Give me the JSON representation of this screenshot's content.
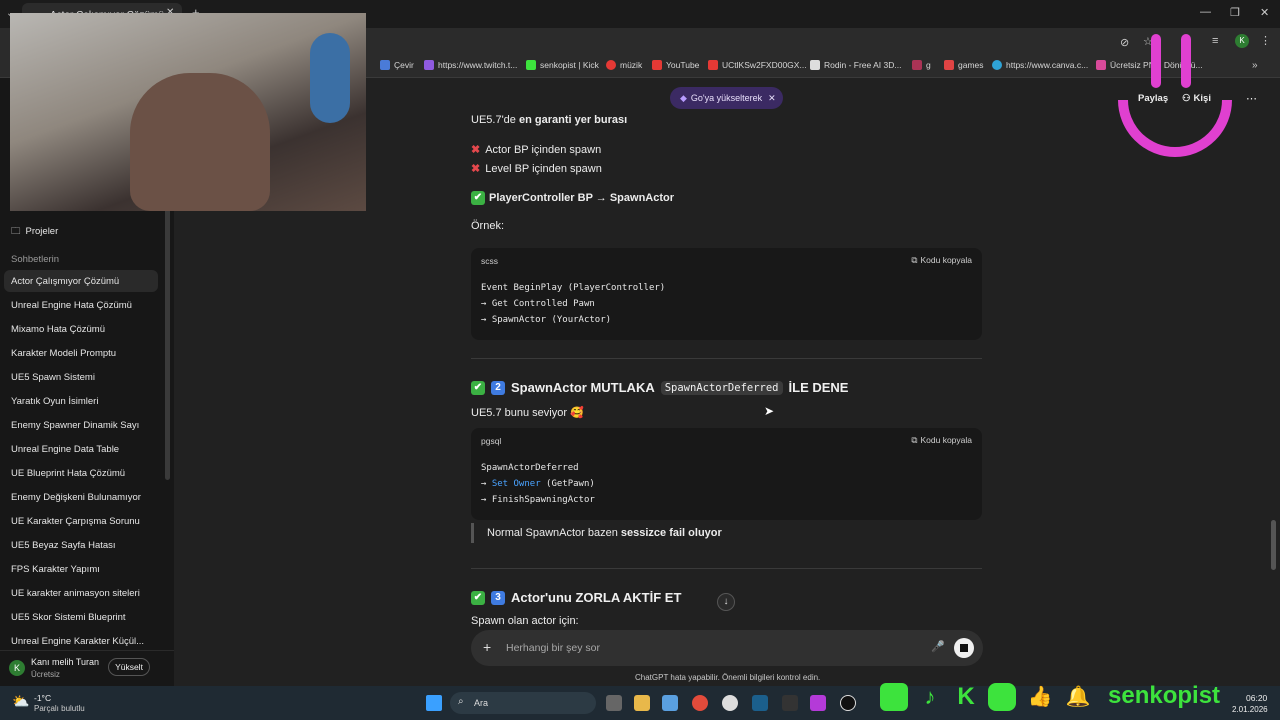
{
  "browser": {
    "tab_title": "Actor Çalışmıyor Çözümü",
    "bookmarks": [
      {
        "label": "Çevir",
        "icon": "translate-icon",
        "color": "#4a7bd8"
      },
      {
        "label": "https://www.twitch.t...",
        "icon": "twitch-icon",
        "color": "#8f5ae0"
      },
      {
        "label": "senkopist | Kick",
        "icon": "kick-icon",
        "color": "#3de33d"
      },
      {
        "label": "müzik",
        "icon": "youtube-music-icon",
        "color": "#e53935"
      },
      {
        "label": "YouTube",
        "icon": "youtube-icon",
        "color": "#e53935"
      },
      {
        "label": "UCtlKSw2FXD00GX...",
        "icon": "youtube-icon",
        "color": "#e53935"
      },
      {
        "label": "Rodin - Free AI 3D...",
        "icon": "rodin-icon",
        "color": "#dddddd"
      },
      {
        "label": "g",
        "icon": "site-icon",
        "color": "#aa3355"
      },
      {
        "label": "games",
        "icon": "game-icon",
        "color": "#e04444"
      },
      {
        "label": "https://www.canva.c...",
        "icon": "canva-icon",
        "color": "#2fa3d6"
      },
      {
        "label": "Ücretsiz PNG Dönüştü...",
        "icon": "png-icon",
        "color": "#d84a9a"
      }
    ]
  },
  "header": {
    "upgrade_label": "Go'ya yükselterek",
    "share_label": "Paylaş",
    "kisi_label": "Kişi"
  },
  "sidebar": {
    "projects_label": "Projeler",
    "chats_heading": "Sohbetlerin",
    "items": [
      "Actor Çalışmıyor Çözümü",
      "Unreal Engine Hata Çözümü",
      "Mixamo Hata Çözümü",
      "Karakter Modeli Promptu",
      "UE5 Spawn Sistemi",
      "Yaratık Oyun İsimleri",
      "Enemy Spawner Dinamik Sayı",
      "Unreal Engine Data Table",
      "UE Blueprint Hata Çözümü",
      "Enemy Değişkeni Bulunamıyor",
      "UE Karakter Çarpışma Sorunu",
      "UE5 Beyaz Sayfa Hatası",
      "FPS Karakter Yapımı",
      "UE karakter animasyon siteleri",
      "UE5 Skor Sistemi Blueprint",
      "Unreal Engine Karakter Küçül..."
    ],
    "user": {
      "initial": "K",
      "name": "Kanı melih Turan",
      "plan": "Ücretsiz",
      "upgrade_button": "Yükselt"
    }
  },
  "content": {
    "intro_prefix": "UE5.7'de ",
    "intro_bold": "en garanti yer burası",
    "bad1": "Actor BP içinden spawn",
    "bad2": "Level BP içinden spawn",
    "good": "PlayerController BP → SpawnActor",
    "example_label": "Örnek:",
    "code1": {
      "lang": "scss",
      "copy": "Kodu kopyala",
      "lines": [
        "Event BeginPlay (PlayerController)",
        "→ Get Controlled Pawn",
        "→ SpawnActor (YourActor)"
      ]
    },
    "section2": {
      "number": "2",
      "prefix": "SpawnActor MUTLAKA",
      "inline_code": "SpawnActorDeferred",
      "suffix": "İLE DENE",
      "sub": "UE5.7 bunu seviyor 🥰"
    },
    "code2": {
      "lang": "pgsql",
      "copy": "Kodu kopyala",
      "line1": "SpawnActorDeferred",
      "line2_arrow": "→ ",
      "line2_kw": "Set Owner",
      "line2_rest": " (GetPawn)",
      "line3": "→ FinishSpawningActor"
    },
    "quote_prefix": "Normal SpawnActor bazen ",
    "quote_bold": "sessizce fail oluyor",
    "section3": {
      "number": "3",
      "title": "Actor'unu ZORLA AKTİF ET",
      "sub": "Spawn olan actor için:"
    }
  },
  "composer": {
    "placeholder": "Herhangi bir şey sor",
    "disclaimer": "ChatGPT hata yapabilir. Önemli bilgileri kontrol edin."
  },
  "taskbar": {
    "weather_temp": "-1°C",
    "weather_desc": "Parçalı bulutlu",
    "search_label": "Ara",
    "time": "06:20",
    "date": "2.01.2026"
  },
  "overlay": {
    "channel_name": "senkopist"
  }
}
